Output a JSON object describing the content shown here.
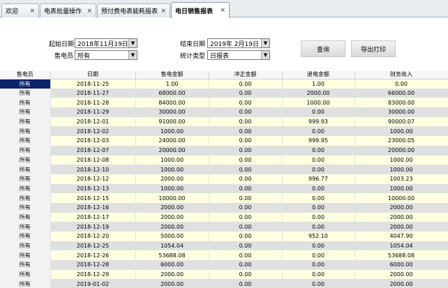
{
  "tabs": [
    {
      "label": "欢迎",
      "close": "×"
    },
    {
      "label": "电表批量操作",
      "close": "×"
    },
    {
      "label": "预付费电表能耗报表",
      "close": "×"
    },
    {
      "label": "电日销售报表",
      "close": "×"
    }
  ],
  "form": {
    "start_date_label": "起始日期",
    "start_date_value": "2018年11月19日",
    "end_date_label": "结束日期",
    "end_date_value": "2019年 2月19日",
    "seller_label": "售电员",
    "seller_value": "所有",
    "stat_type_label": "统计类型",
    "stat_type_value": "日报表",
    "query_button": "查询",
    "export_button": "导出打印"
  },
  "table": {
    "headers": [
      "售电员",
      "日期",
      "售电金额",
      "冲正金额",
      "退电金额",
      "财务收入"
    ],
    "rows": [
      [
        "所有",
        "2018-11-25",
        "1.00",
        "0.00",
        "1.00",
        "0.00"
      ],
      [
        "所有",
        "2018-11-27",
        "68000.00",
        "0.00",
        "2000.00",
        "66000.00"
      ],
      [
        "所有",
        "2018-11-28",
        "84000.00",
        "0.00",
        "1000.00",
        "83000.00"
      ],
      [
        "所有",
        "2018-11-29",
        "30000.00",
        "0.00",
        "0.00",
        "30000.00"
      ],
      [
        "所有",
        "2018-12-01",
        "91000.00",
        "0.00",
        "999.93",
        "90000.07"
      ],
      [
        "所有",
        "2018-12-02",
        "1000.00",
        "0.00",
        "0.00",
        "1000.00"
      ],
      [
        "所有",
        "2018-12-03",
        "24000.00",
        "0.00",
        "999.95",
        "23000.05"
      ],
      [
        "所有",
        "2018-12-07",
        "20000.00",
        "0.00",
        "0.00",
        "20000.00"
      ],
      [
        "所有",
        "2018-12-08",
        "1000.00",
        "0.00",
        "0.00",
        "1000.00"
      ],
      [
        "所有",
        "2018-12-10",
        "1000.00",
        "0.00",
        "0.00",
        "1000.00"
      ],
      [
        "所有",
        "2018-12-12",
        "2000.00",
        "0.00",
        "996.77",
        "1003.23"
      ],
      [
        "所有",
        "2018-12-13",
        "1000.00",
        "0.00",
        "0.00",
        "1000.00"
      ],
      [
        "所有",
        "2018-12-15",
        "10000.00",
        "0.00",
        "0.00",
        "10000.00"
      ],
      [
        "所有",
        "2018-12-16",
        "2000.00",
        "0.00",
        "0.00",
        "2000.00"
      ],
      [
        "所有",
        "2018-12-17",
        "2000.00",
        "0.00",
        "0.00",
        "2000.00"
      ],
      [
        "所有",
        "2018-12-19",
        "2000.00",
        "0.00",
        "0.00",
        "2000.00"
      ],
      [
        "所有",
        "2018-12-20",
        "5000.00",
        "0.00",
        "952.10",
        "4047.90"
      ],
      [
        "所有",
        "2018-12-25",
        "1054.04",
        "0.00",
        "0.00",
        "1054.04"
      ],
      [
        "所有",
        "2018-12-26",
        "53688.08",
        "0.00",
        "0.00",
        "53688.08"
      ],
      [
        "所有",
        "2018-12-28",
        "6000.00",
        "0.00",
        "0.00",
        "6000.00"
      ],
      [
        "所有",
        "2018-12-29",
        "2000.00",
        "0.00",
        "0.00",
        "2000.00"
      ],
      [
        "所有",
        "2019-01-02",
        "2000.00",
        "0.00",
        "0.00",
        "2000.00"
      ]
    ]
  }
}
